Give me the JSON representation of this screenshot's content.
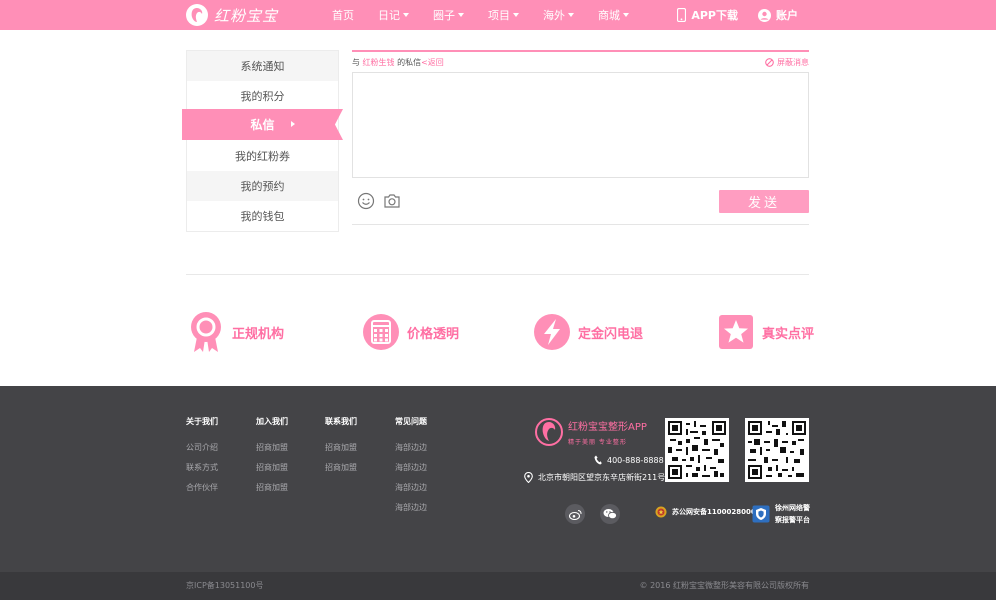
{
  "header": {
    "logo_text": "红粉宝宝",
    "nav": [
      {
        "label": "首页",
        "dropdown": false
      },
      {
        "label": "日记",
        "dropdown": true
      },
      {
        "label": "圈子",
        "dropdown": true
      },
      {
        "label": "项目",
        "dropdown": true
      },
      {
        "label": "海外",
        "dropdown": true
      },
      {
        "label": "商城",
        "dropdown": true
      }
    ],
    "app_download": "APP下载",
    "account": "账户"
  },
  "sidebar": {
    "items": [
      "系统通知",
      "我的积分",
      "私信",
      "我的红粉券",
      "我的预约",
      "我的钱包"
    ],
    "active": "私信"
  },
  "message": {
    "prefix": "与",
    "contact": "红粉生钱",
    "suffix": "的私信",
    "back": "<返回",
    "block": "屏蔽消息",
    "send": "发送"
  },
  "features": [
    {
      "label": "正规机构",
      "icon": "ribbon-badge-icon"
    },
    {
      "label": "价格透明",
      "icon": "calculator-icon"
    },
    {
      "label": "定金闪电退",
      "icon": "lightning-icon"
    },
    {
      "label": "真实点评",
      "icon": "star-icon"
    }
  ],
  "footer": {
    "columns": [
      {
        "head": "关于我们",
        "links": [
          "公司介绍",
          "联系方式",
          "合作伙伴"
        ]
      },
      {
        "head": "加入我们",
        "links": [
          "招商加盟",
          "招商加盟",
          "招商加盟"
        ]
      },
      {
        "head": "联系我们",
        "links": [
          "招商加盟",
          "招商加盟"
        ]
      },
      {
        "head": "常见问题",
        "links": [
          "海部边边",
          "海部边边",
          "海部边边",
          "海部边边"
        ]
      }
    ],
    "app_name": "红粉宝宝整形APP",
    "app_slogan": "精于美丽 专业整形",
    "phone": "400-888-8888",
    "address": "北京市朝阳区望京东辛店新街211号",
    "police_record": "苏公网安备1100028000",
    "police_platform_line1": "徐州网络警",
    "police_platform_line2": "察报警平台",
    "icp": "京ICP备13051100号",
    "copyright": "© 2016 红粉宝宝微整形美容有限公司版权所有"
  },
  "colors": {
    "brand_pink": "#ff8fb7",
    "accent_pink": "#ff6fa3",
    "footer_dark": "#444447"
  }
}
